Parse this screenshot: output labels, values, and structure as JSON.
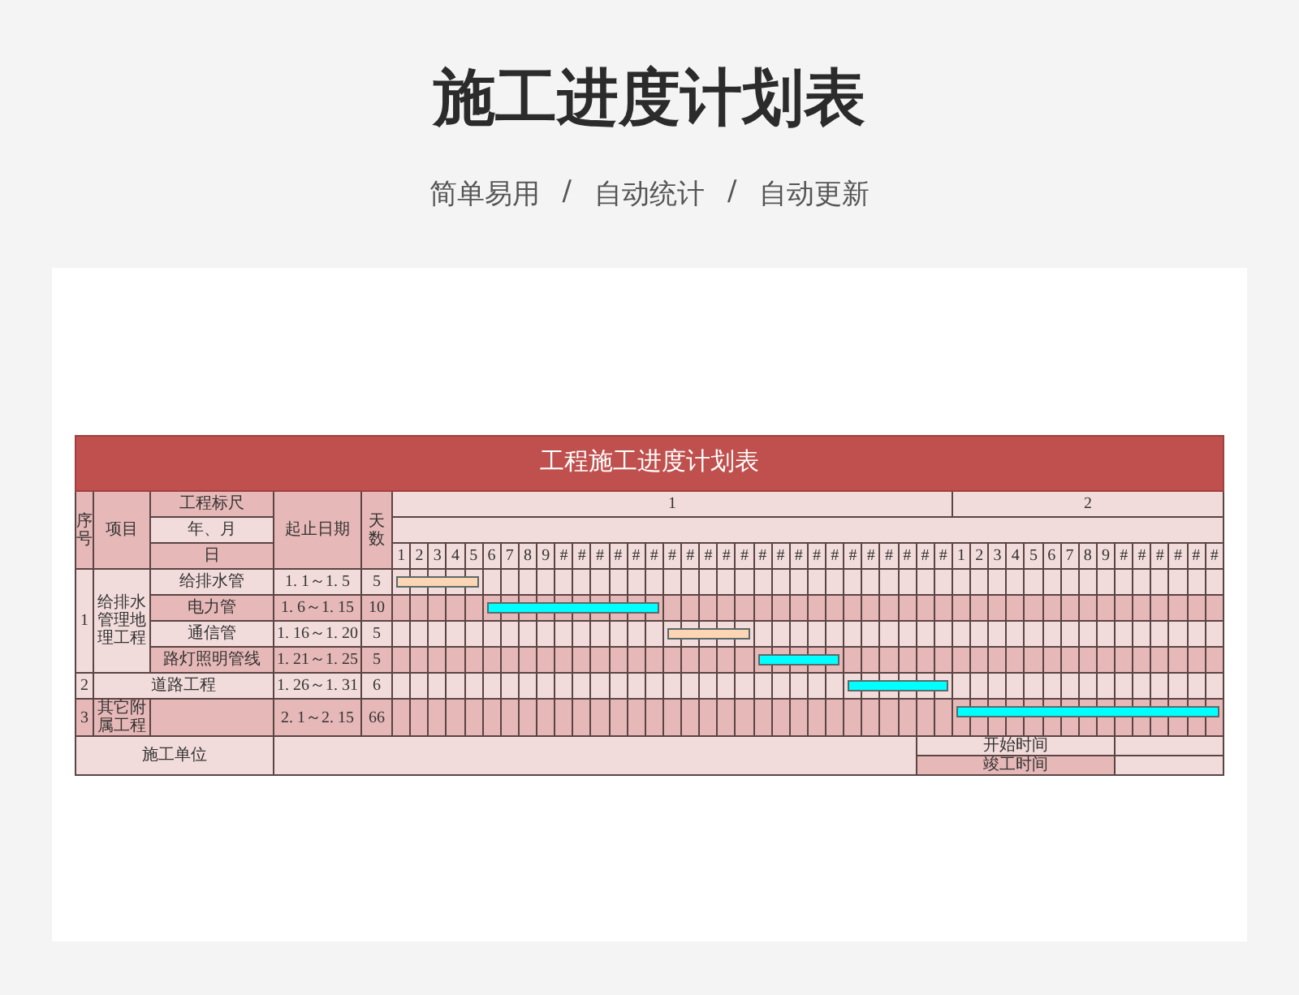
{
  "page": {
    "title": "施工进度计划表",
    "subtitle": [
      "简单易用",
      "/",
      "自动统计",
      "/",
      "自动更新"
    ]
  },
  "table": {
    "title": "工程施工进度计划表",
    "header": {
      "seq": "序号",
      "item": "项目",
      "scale_labels": [
        "工程标尺",
        "年、月",
        "日"
      ],
      "dates": "起止日期",
      "days": "天数",
      "months": [
        {
          "label": "1",
          "days": [
            "1",
            "2",
            "3",
            "4",
            "5",
            "6",
            "7",
            "8",
            "9",
            "#",
            "#",
            "#",
            "#",
            "#",
            "#",
            "#",
            "#",
            "#",
            "#",
            "#",
            "#",
            "#",
            "#",
            "#",
            "#",
            "#",
            "#",
            "#",
            "#",
            "#",
            "#"
          ]
        },
        {
          "label": "2",
          "days": [
            "1",
            "2",
            "3",
            "4",
            "5",
            "6",
            "7",
            "8",
            "9",
            "#",
            "#",
            "#",
            "#",
            "#",
            "#"
          ]
        }
      ]
    },
    "groups": [
      {
        "kind": "group",
        "seq": "1",
        "project": "给排水管理地理工程",
        "tasks": [
          {
            "name": "给排水管",
            "dates": "1. 1～1. 5",
            "days": "5",
            "bar": {
              "color": "#fcd5b4",
              "cells": [
                true,
                true,
                true,
                true,
                true,
                false,
                false,
                false,
                false,
                false,
                false,
                false,
                false,
                false,
                false,
                false,
                false,
                false,
                false,
                false,
                false,
                false,
                false,
                false,
                false,
                false,
                false,
                false,
                false,
                false,
                false,
                false,
                false,
                false,
                false,
                false,
                false,
                false,
                false,
                false,
                false,
                false,
                false,
                false,
                false,
                false
              ]
            }
          },
          {
            "name": "电力管",
            "dates": "1. 6～1. 15",
            "days": "10",
            "bar": {
              "color": "#00ffff",
              "cells": [
                false,
                false,
                false,
                false,
                false,
                true,
                true,
                true,
                true,
                true,
                true,
                true,
                true,
                true,
                true,
                false,
                false,
                false,
                false,
                false,
                false,
                false,
                false,
                false,
                false,
                false,
                false,
                false,
                false,
                false,
                false,
                false,
                false,
                false,
                false,
                false,
                false,
                false,
                false,
                false,
                false,
                false,
                false,
                false,
                false,
                false
              ]
            }
          },
          {
            "name": "通信管",
            "dates": "1. 16～1. 20",
            "days": "5",
            "bar": {
              "color": "#fcd5b4",
              "cells": [
                false,
                false,
                false,
                false,
                false,
                false,
                false,
                false,
                false,
                false,
                false,
                false,
                false,
                false,
                false,
                true,
                true,
                true,
                true,
                true,
                false,
                false,
                false,
                false,
                false,
                false,
                false,
                false,
                false,
                false,
                false,
                false,
                false,
                false,
                false,
                false,
                false,
                false,
                false,
                false,
                false,
                false,
                false,
                false,
                false,
                false
              ]
            }
          },
          {
            "name": "路灯照明管线",
            "dates": "1. 21～1. 25",
            "days": "5",
            "bar": {
              "color": "#00ffff",
              "cells": [
                false,
                false,
                false,
                false,
                false,
                false,
                false,
                false,
                false,
                false,
                false,
                false,
                false,
                false,
                false,
                false,
                false,
                false,
                false,
                false,
                true,
                true,
                true,
                true,
                true,
                false,
                false,
                false,
                false,
                false,
                false,
                false,
                false,
                false,
                false,
                false,
                false,
                false,
                false,
                false,
                false,
                false,
                false,
                false,
                false,
                false
              ]
            }
          }
        ]
      },
      {
        "kind": "wide",
        "seq": "2",
        "project": "道路工程",
        "tasks": [
          {
            "dates": "1. 26～1. 31",
            "days": "6",
            "bar": {
              "color": "#00ffff",
              "cells": [
                false,
                false,
                false,
                false,
                false,
                false,
                false,
                false,
                false,
                false,
                false,
                false,
                false,
                false,
                false,
                false,
                false,
                false,
                false,
                false,
                false,
                false,
                false,
                false,
                false,
                true,
                true,
                true,
                true,
                true,
                true,
                false,
                false,
                false,
                false,
                false,
                false,
                false,
                false,
                false,
                false,
                false,
                false,
                false,
                false,
                false
              ]
            }
          }
        ]
      },
      {
        "kind": "plain",
        "seq": "3",
        "project": "其它附属工程",
        "tasks": [
          {
            "dates": "2. 1～2. 15",
            "days": "66",
            "bar": {
              "color": "#00ffff",
              "cells": [
                false,
                false,
                false,
                false,
                false,
                false,
                false,
                false,
                false,
                false,
                false,
                false,
                false,
                false,
                false,
                false,
                false,
                false,
                false,
                false,
                false,
                false,
                false,
                false,
                false,
                false,
                false,
                false,
                false,
                false,
                false,
                true,
                true,
                true,
                true,
                true,
                true,
                true,
                true,
                true,
                true,
                true,
                true,
                true,
                true,
                true
              ]
            }
          }
        ]
      }
    ],
    "footer": {
      "unit_label": "施工单位",
      "start_label": "开始时间",
      "end_label": "竣工时间"
    }
  }
}
